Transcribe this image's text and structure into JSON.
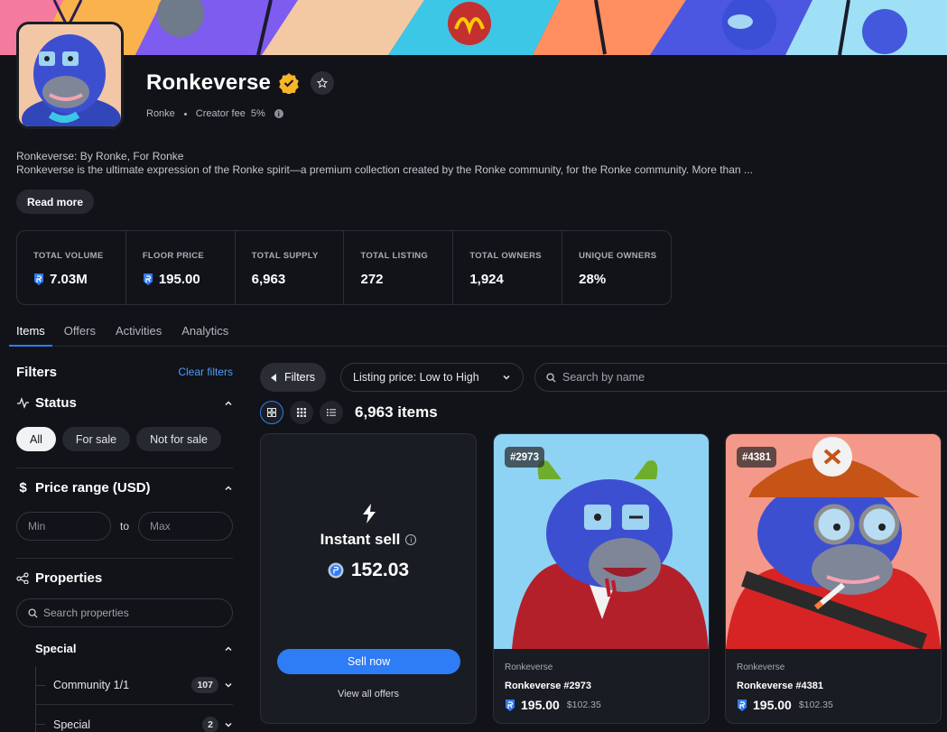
{
  "collection": {
    "name": "Ronkeverse",
    "creator": "Ronke",
    "creator_fee_label": "Creator fee",
    "creator_fee": "5%",
    "tagline": "Ronkeverse: By Ronke, For Ronke",
    "description": "Ronkeverse is the ultimate expression of the Ronke spirit—a premium collection created by the Ronke community, for the Ronke community. More than ...",
    "read_more": "Read more"
  },
  "stats": [
    {
      "label": "TOTAL VOLUME",
      "value": "7.03M",
      "currency_icon": true
    },
    {
      "label": "FLOOR PRICE",
      "value": "195.00",
      "currency_icon": true
    },
    {
      "label": "TOTAL SUPPLY",
      "value": "6,963",
      "currency_icon": false
    },
    {
      "label": "TOTAL LISTING",
      "value": "272",
      "currency_icon": false
    },
    {
      "label": "TOTAL OWNERS",
      "value": "1,924",
      "currency_icon": false
    },
    {
      "label": "UNIQUE OWNERS",
      "value": "28%",
      "currency_icon": false
    }
  ],
  "tabs": [
    "Items",
    "Offers",
    "Activities",
    "Analytics"
  ],
  "sidebar": {
    "title": "Filters",
    "clear": "Clear filters",
    "status": {
      "title": "Status",
      "options": [
        "All",
        "For sale",
        "Not for sale"
      ],
      "selected": "All"
    },
    "price": {
      "title": "Price range (USD)",
      "min_placeholder": "Min",
      "max_placeholder": "Max",
      "to": "to"
    },
    "properties": {
      "title": "Properties",
      "search_placeholder": "Search properties",
      "group": "Special",
      "items": [
        {
          "name": "Community 1/1",
          "count": "107"
        },
        {
          "name": "Special",
          "count": "2"
        }
      ]
    }
  },
  "toolbar": {
    "filters": "Filters",
    "sort": "Listing price: Low to High",
    "search_placeholder": "Search by name",
    "count": "6,963 items"
  },
  "instant_sell": {
    "title": "Instant sell",
    "price": "152.03",
    "button": "Sell now",
    "link": "View all offers"
  },
  "items": [
    {
      "tag": "#2973",
      "collection": "Ronkeverse",
      "name": "Ronkeverse #2973",
      "price": "195.00",
      "usd": "$102.35",
      "bg": "#8fd3f4"
    },
    {
      "tag": "#4381",
      "collection": "Ronkeverse",
      "name": "Ronkeverse #4381",
      "price": "195.00",
      "usd": "$102.35",
      "bg": "#f4988a"
    }
  ],
  "colors": {
    "accent": "#2e7cf6",
    "background": "#111318",
    "card": "#191c22",
    "link": "#4d9bf7"
  }
}
